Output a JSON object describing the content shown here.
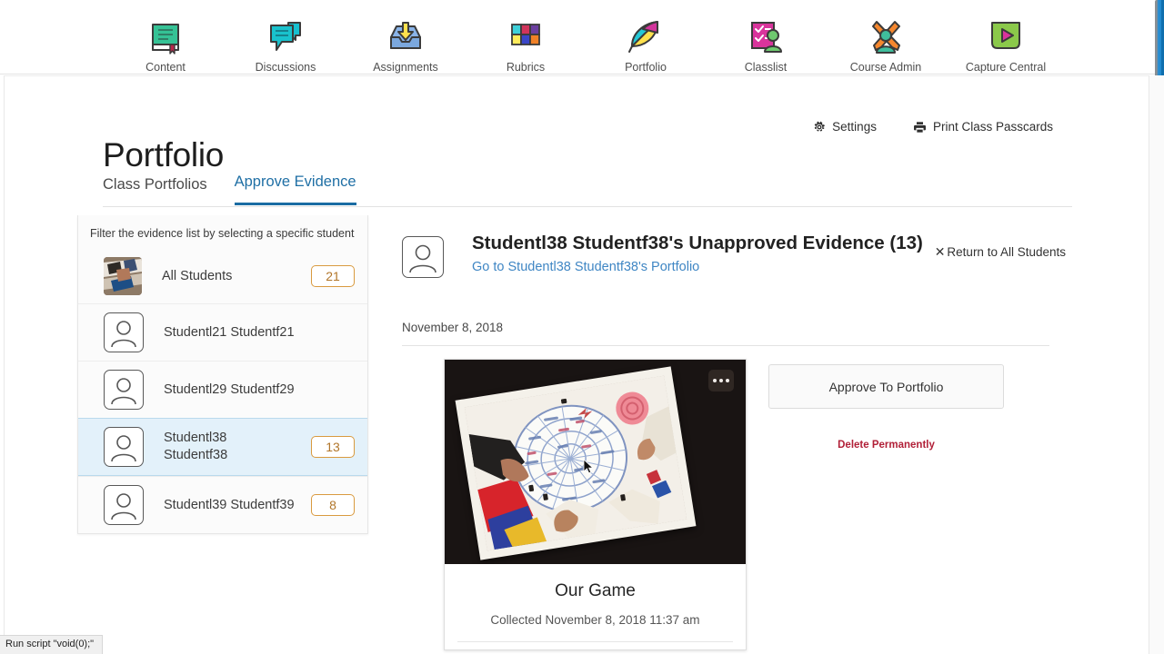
{
  "topnav": {
    "items": [
      {
        "label": "Content",
        "icon": "book-icon"
      },
      {
        "label": "Discussions",
        "icon": "speech-bubbles-icon"
      },
      {
        "label": "Assignments",
        "icon": "inbox-down-arrow-icon"
      },
      {
        "label": "Rubrics",
        "icon": "grid-squares-icon"
      },
      {
        "label": "Portfolio",
        "icon": "leaf-icon"
      },
      {
        "label": "Classlist",
        "icon": "checklist-person-icon"
      },
      {
        "label": "Course Admin",
        "icon": "wrench-person-icon"
      },
      {
        "label": "Capture Central",
        "icon": "play-button-icon"
      }
    ]
  },
  "header": {
    "title": "Portfolio",
    "actions": [
      {
        "label": "Settings",
        "icon": "gear-icon"
      },
      {
        "label": "Print Class Passcards",
        "icon": "printer-icon"
      }
    ]
  },
  "tabs": [
    {
      "label": "Class Portfolios",
      "active": false
    },
    {
      "label": "Approve Evidence",
      "active": true
    }
  ],
  "sidebar": {
    "hint": "Filter the evidence list by selecting a specific student",
    "students": [
      {
        "name": "All Students",
        "count": "21",
        "selected": false,
        "avatar": "photo"
      },
      {
        "name": "Studentl21 Studentf21",
        "count": "",
        "selected": false,
        "avatar": "placeholder"
      },
      {
        "name": "Studentl29 Studentf29",
        "count": "",
        "selected": false,
        "avatar": "placeholder"
      },
      {
        "name": "Studentl38\nStudentf38",
        "count": "13",
        "selected": true,
        "avatar": "placeholder"
      },
      {
        "name": "Studentl39 Studentf39",
        "count": "8",
        "selected": false,
        "avatar": "placeholder"
      }
    ]
  },
  "evidence": {
    "heading": "Studentl38 Studentf38's Unapproved Evidence (13)",
    "portfolio_link": "Go to Studentl38 Studentf38's Portfolio",
    "return_link": "Return to All Students",
    "date_group": "November 8, 2018",
    "card": {
      "title": "Our Game",
      "collected": "Collected November 8, 2018 11:37 am",
      "menu_icon": "ellipsis-icon"
    },
    "approve_label": "Approve To Portfolio",
    "delete_label": "Delete Permanently"
  },
  "statusbar": {
    "text": "Run script \"void(0);\""
  },
  "colors": {
    "tab_active": "#1a6ca3",
    "link": "#3f86c4",
    "badge_border": "#d99a3f",
    "badge_text": "#b1762a",
    "delete_text": "#b11f37",
    "selected_row": "#e3f1fa"
  }
}
